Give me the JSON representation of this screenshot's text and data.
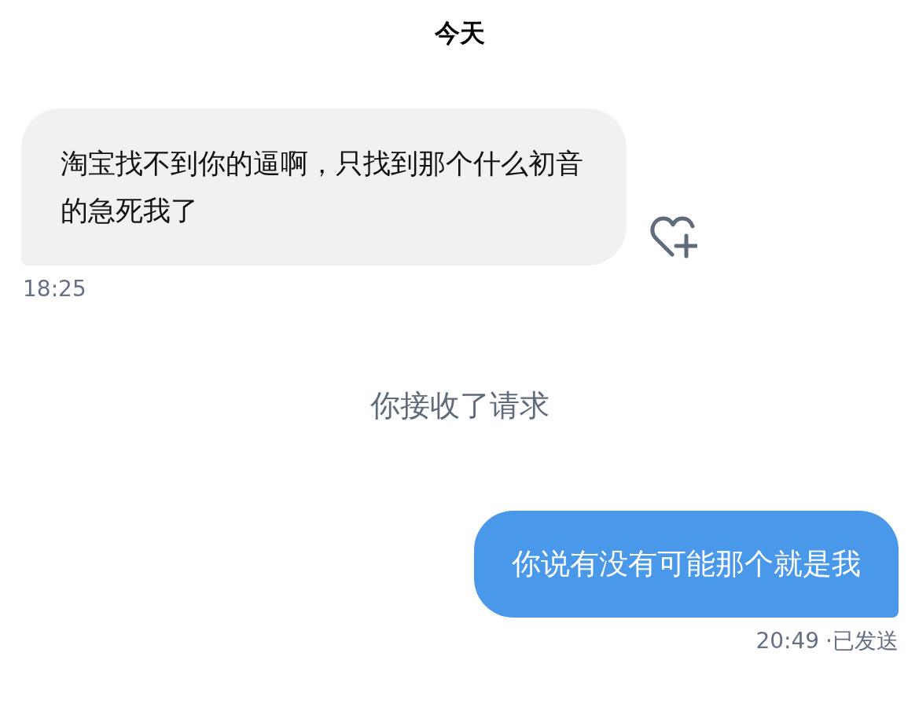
{
  "date_header": "今天",
  "messages": [
    {
      "kind": "received",
      "text": "淘宝找不到你的逼啊，只找到那个什么初音的急死我了",
      "time": "18:25"
    },
    {
      "kind": "system",
      "text": "你接收了请求"
    },
    {
      "kind": "sent",
      "text": "你说有没有可能那个就是我",
      "time": "20:49",
      "status": "·已发送"
    }
  ]
}
